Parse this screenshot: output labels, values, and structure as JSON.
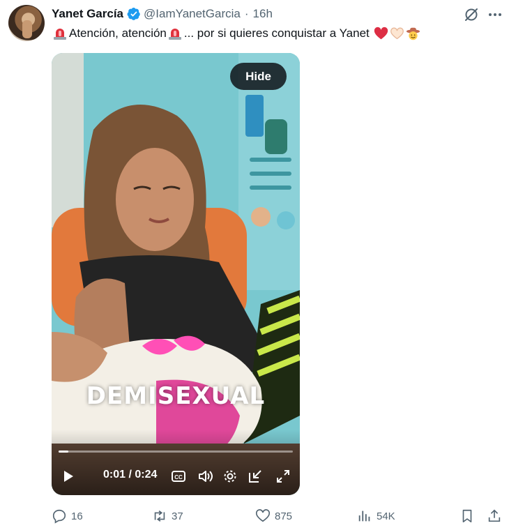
{
  "author": {
    "name": "Yanet García",
    "handle": "@IamYanetGarcia",
    "separator": "·",
    "time": "16h",
    "verified": true
  },
  "tweet": {
    "text_part1": "Atención, atención",
    "text_part2": "... por si quieres conquistar a Yanet",
    "emojis": [
      "police-light",
      "police-light",
      "red-heart",
      "heart-hands",
      "cowboy-face"
    ]
  },
  "media": {
    "hide_label": "Hide",
    "caption": "DEMISEXUAL",
    "time_display": "0:01 / 0:24",
    "progress_fraction": 0.042
  },
  "actions": {
    "replies": "16",
    "reposts": "37",
    "likes": "875",
    "views": "54K"
  },
  "colors": {
    "text": "#0f1419",
    "secondary": "#536471",
    "verified": "#1d9bf0"
  }
}
